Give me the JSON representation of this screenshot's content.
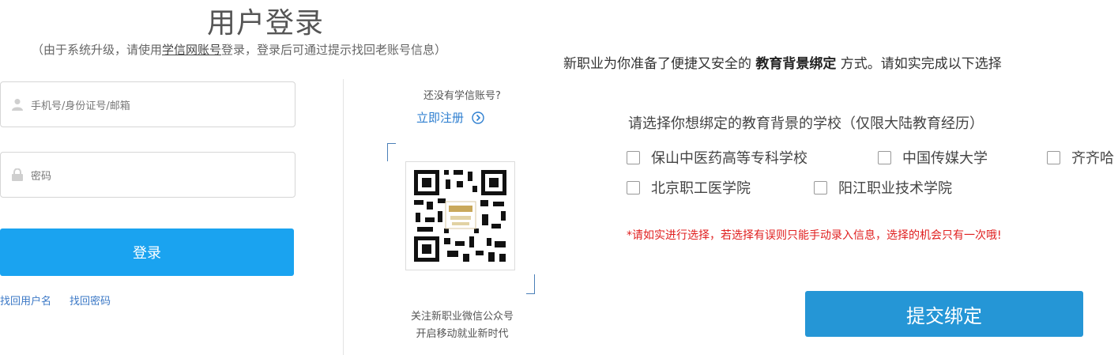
{
  "login": {
    "title": "用户登录",
    "subtitle_pre": "（由于系统升级，请使用",
    "subtitle_link": "学信网账号",
    "subtitle_post": "登录，登录后可通过提示找回老账号信息）",
    "username_placeholder": "手机号/身份证号/邮箱",
    "password_placeholder": "密码",
    "login_button": "登录",
    "find_username": "找回用户名",
    "find_password": "找回密码"
  },
  "qr_panel": {
    "no_account": "还没有学信账号?",
    "register_link": "立即注册",
    "caption_line1": "关注新职业微信公众号",
    "caption_line2": "开启移动就业新时代"
  },
  "binding": {
    "intro_pre": "新职业为你准备了便捷又安全的 ",
    "intro_bold": "教育背景绑定",
    "intro_post": " 方式。请如实完成以下选择",
    "school_hint": "请选择你想绑定的教育背景的学校（仅限大陆教育经历）",
    "schools": [
      "保山中医药高等专科学校",
      "中国传媒大学",
      "齐齐哈",
      "北京职工医学院",
      "阳江职业技术学院"
    ],
    "warning": "*请如实进行选择，若选择有误则只能手动录入信息，选择的机会只有一次哦!",
    "submit_button": "提交绑定"
  },
  "colors": {
    "login_button": "#1aa3f0",
    "submit_button": "#2596d6",
    "link": "#3b78c6",
    "warning": "#e02020"
  }
}
